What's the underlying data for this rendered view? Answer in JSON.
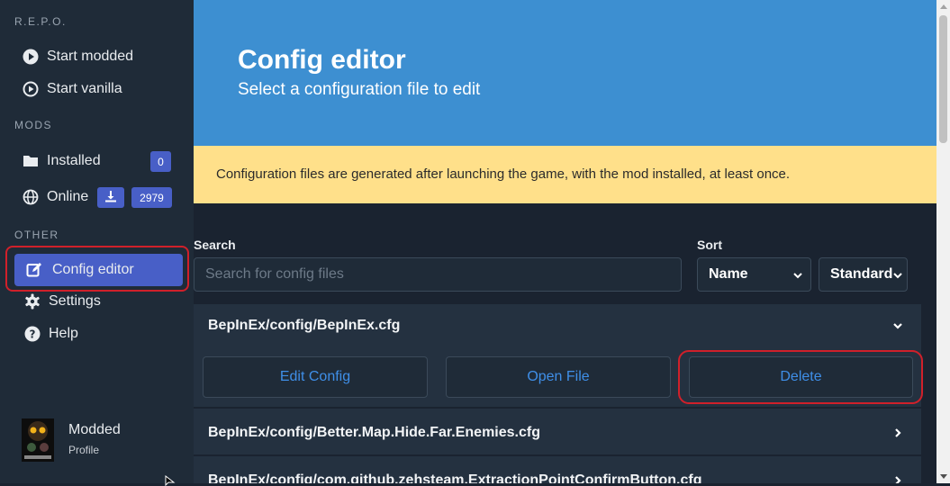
{
  "sidebar": {
    "section_game": "R.E.P.O.",
    "start_modded": "Start modded",
    "start_vanilla": "Start vanilla",
    "section_mods": "MODS",
    "installed": "Installed",
    "installed_count": "0",
    "online": "Online",
    "online_count": "2979",
    "section_other": "OTHER",
    "config_editor": "Config editor",
    "settings": "Settings",
    "help": "Help",
    "profile_name": "Modded",
    "profile_sub": "Profile",
    "icons": {
      "start_modded": "play-circle-icon",
      "start_vanilla": "play-circle-outline-icon",
      "installed": "folder-icon",
      "online": "globe-icon",
      "download": "download-icon",
      "config_editor": "edit-icon",
      "settings": "gear-icon",
      "help": "question-circle-icon"
    }
  },
  "hero": {
    "title": "Config editor",
    "subtitle": "Select a configuration file to edit"
  },
  "notice": {
    "text": "Configuration files are generated after launching the game, with the mod installed, at least once."
  },
  "filters": {
    "search_label": "Search",
    "search_placeholder": "Search for config files",
    "search_value": "",
    "sort_label": "Sort",
    "sort_by": "Name",
    "sort_order": "Standard"
  },
  "configs": [
    {
      "path": "BepInEx/config/BepInEx.cfg",
      "expanded": true,
      "actions": {
        "edit": "Edit Config",
        "open": "Open File",
        "delete": "Delete"
      }
    },
    {
      "path": "BepInEx/config/Better.Map.Hide.Far.Enemies.cfg",
      "expanded": false
    },
    {
      "path": "BepInEx/config/com.github.zehsteam.ExtractionPointConfirmButton.cfg",
      "expanded": false
    }
  ],
  "colors": {
    "sidebar_bg": "#1f2b38",
    "main_bg": "#1a2330",
    "hero_bg": "#3d8fd1",
    "notice_bg": "#ffe08a",
    "accent": "#485fc7",
    "link": "#3f8fe8",
    "annotation": "#d0202a"
  }
}
